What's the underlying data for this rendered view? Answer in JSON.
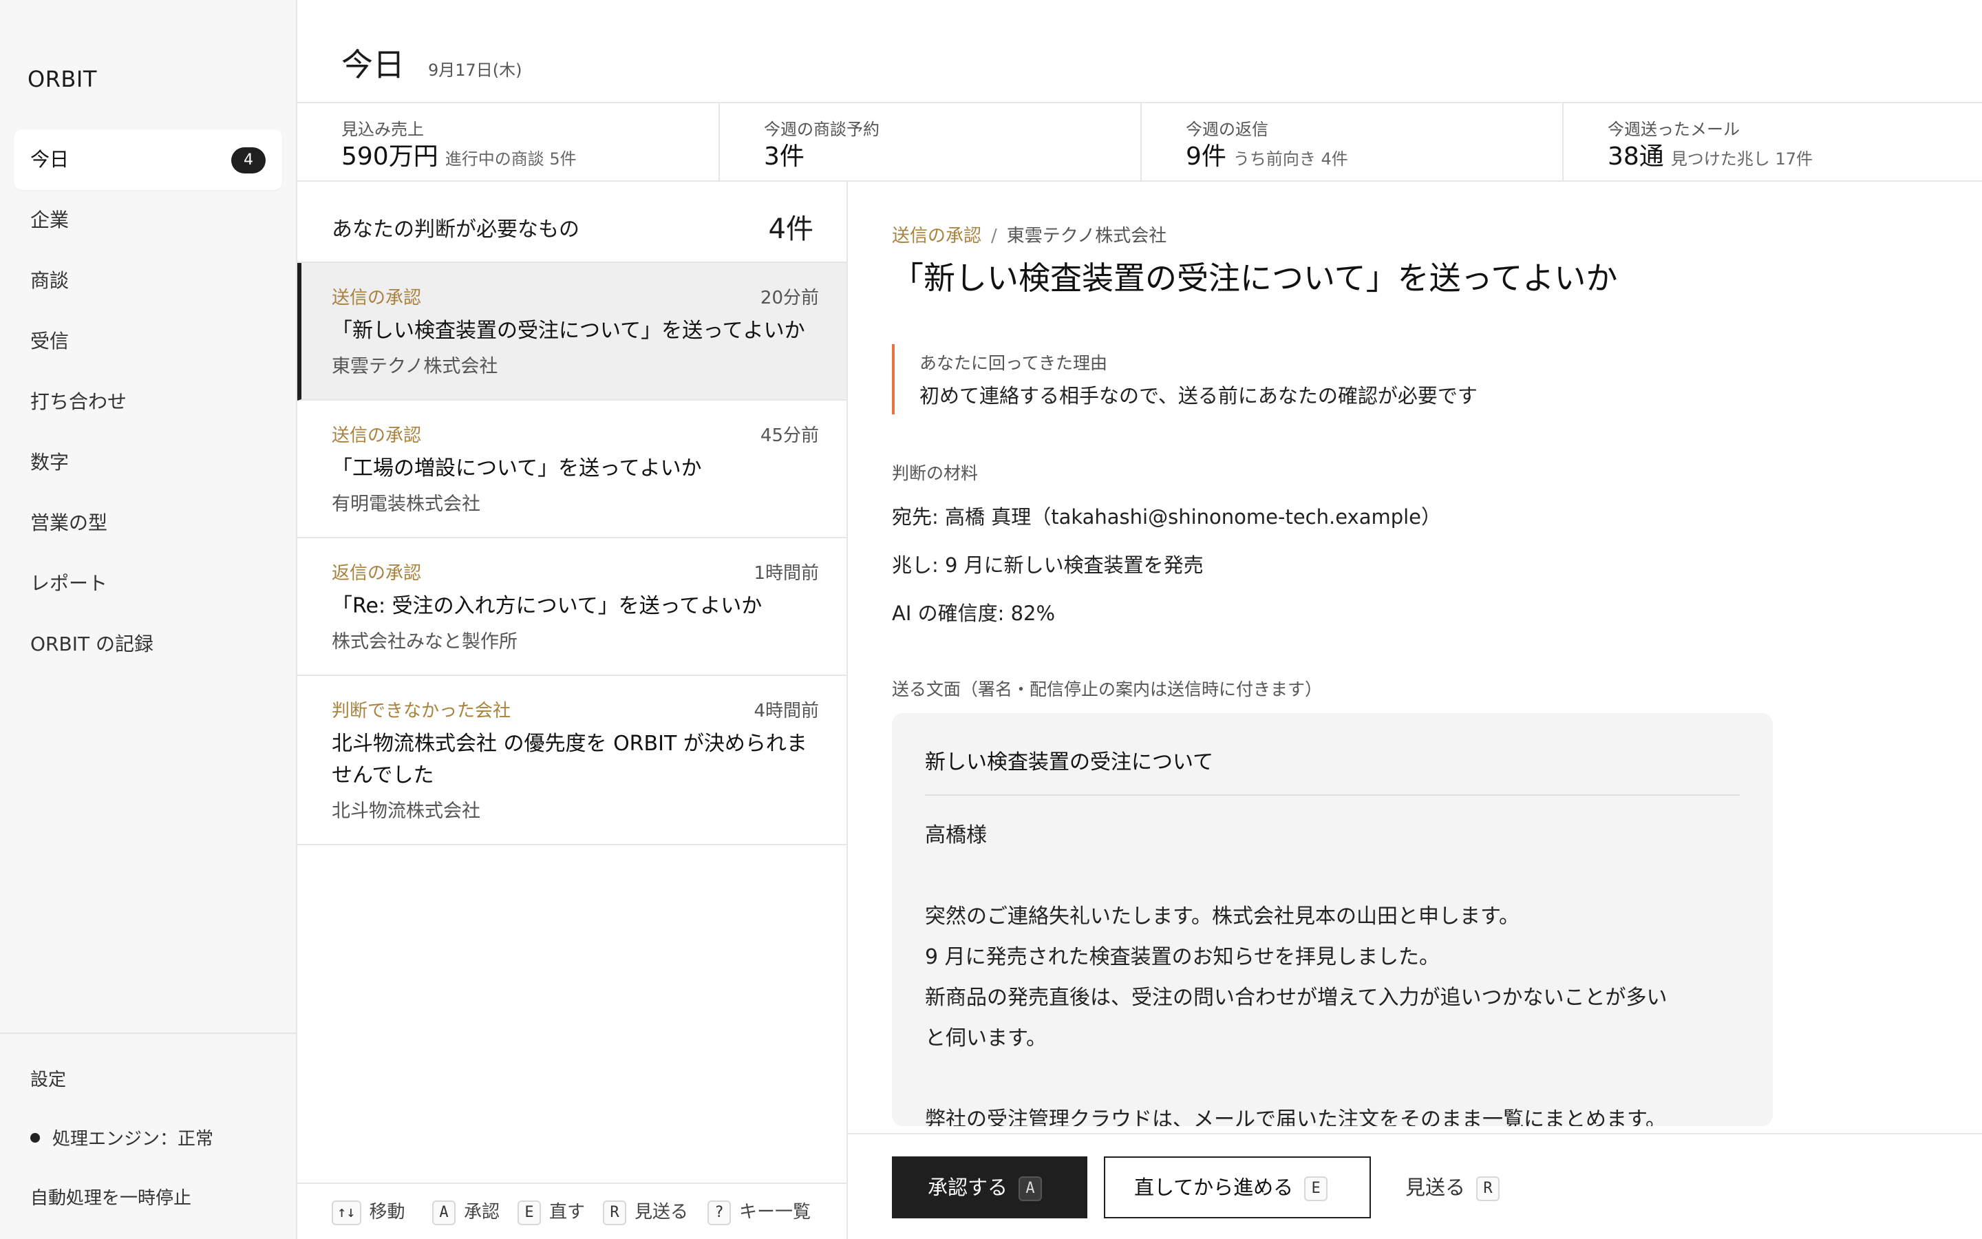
{
  "app": {
    "name": "ORBIT"
  },
  "sidebar": {
    "items": [
      {
        "label": "今日",
        "badge": "4",
        "active": true
      },
      {
        "label": "企業"
      },
      {
        "label": "商談"
      },
      {
        "label": "受信"
      },
      {
        "label": "打ち合わせ"
      },
      {
        "label": "数字"
      },
      {
        "label": "営業の型"
      },
      {
        "label": "レポート"
      },
      {
        "label": "ORBIT の記録"
      }
    ],
    "settings_label": "設定",
    "engine_status": "処理エンジン：正常",
    "pause_label": "自動処理を一時停止"
  },
  "header": {
    "title": "今日",
    "date": "9月17日(木)"
  },
  "stats": [
    {
      "label": "見込み売上",
      "value": "590万円",
      "sub": "進行中の商談 5件"
    },
    {
      "label": "今週の商談予約",
      "value": "3件",
      "sub": ""
    },
    {
      "label": "今週の返信",
      "value": "9件",
      "sub": "うち前向き 4件"
    },
    {
      "label": "今週送ったメール",
      "value": "38通",
      "sub": "見つけた兆し 17件"
    }
  ],
  "queue": {
    "title": "あなたの判断が必要なもの",
    "count": "4件",
    "items": [
      {
        "category": "送信の承認",
        "time": "20分前",
        "title": "「新しい検査装置の受注について」を送ってよいか",
        "company": "東雲テクノ株式会社"
      },
      {
        "category": "送信の承認",
        "time": "45分前",
        "title": "「工場の増設について」を送ってよいか",
        "company": "有明電装株式会社"
      },
      {
        "category": "返信の承認",
        "time": "1時間前",
        "title": "「Re: 受注の入れ方について」を送ってよいか",
        "company": "株式会社みなと製作所"
      },
      {
        "category": "判断できなかった会社",
        "time": "4時間前",
        "title": "北斗物流株式会社 の優先度を ORBIT が決められませんでした",
        "company": "北斗物流株式会社"
      }
    ],
    "shortcuts": [
      {
        "key": "↑↓",
        "label": "移動"
      },
      {
        "key": "A",
        "label": "承認"
      },
      {
        "key": "E",
        "label": "直す"
      },
      {
        "key": "R",
        "label": "見送る"
      },
      {
        "key": "?",
        "label": "キー一覧"
      }
    ]
  },
  "detail": {
    "breadcrumb": {
      "category": "送信の承認",
      "separator": "/",
      "company": "東雲テクノ株式会社"
    },
    "title": "「新しい検査装置の受注について」を送ってよいか",
    "reason": {
      "label": "あなたに回ってきた理由",
      "text": "初めて連絡する相手なので、送る前にあなたの確認が必要です"
    },
    "materials": {
      "label": "判断の材料",
      "recipient": "宛先: 高橋 真理（takahashi@shinonome-tech.example）",
      "signal": "兆し: 9 月に新しい検査装置を発売",
      "confidence": "AI の確信度: 82%"
    },
    "draft": {
      "label": "送る文面（署名・配信停止の案内は送信時に付きます）",
      "subject": "新しい検査装置の受注について",
      "body": [
        "高橋様",
        "",
        "突然のご連絡失礼いたします。株式会社見本の山田と申します。",
        "9 月に発売された検査装置のお知らせを拝見しました。",
        "新商品の発売直後は、受注の問い合わせが増えて入力が追いつかないことが多い",
        "と伺います。",
        "",
        "弊社の受注管理クラウドは、メールで届いた注文をそのまま一覧にまとめます。"
      ]
    },
    "actions": {
      "approve": {
        "label": "承認する",
        "key": "A"
      },
      "edit": {
        "label": "直してから進める",
        "key": "E"
      },
      "skip": {
        "label": "見送る",
        "key": "R"
      }
    }
  }
}
